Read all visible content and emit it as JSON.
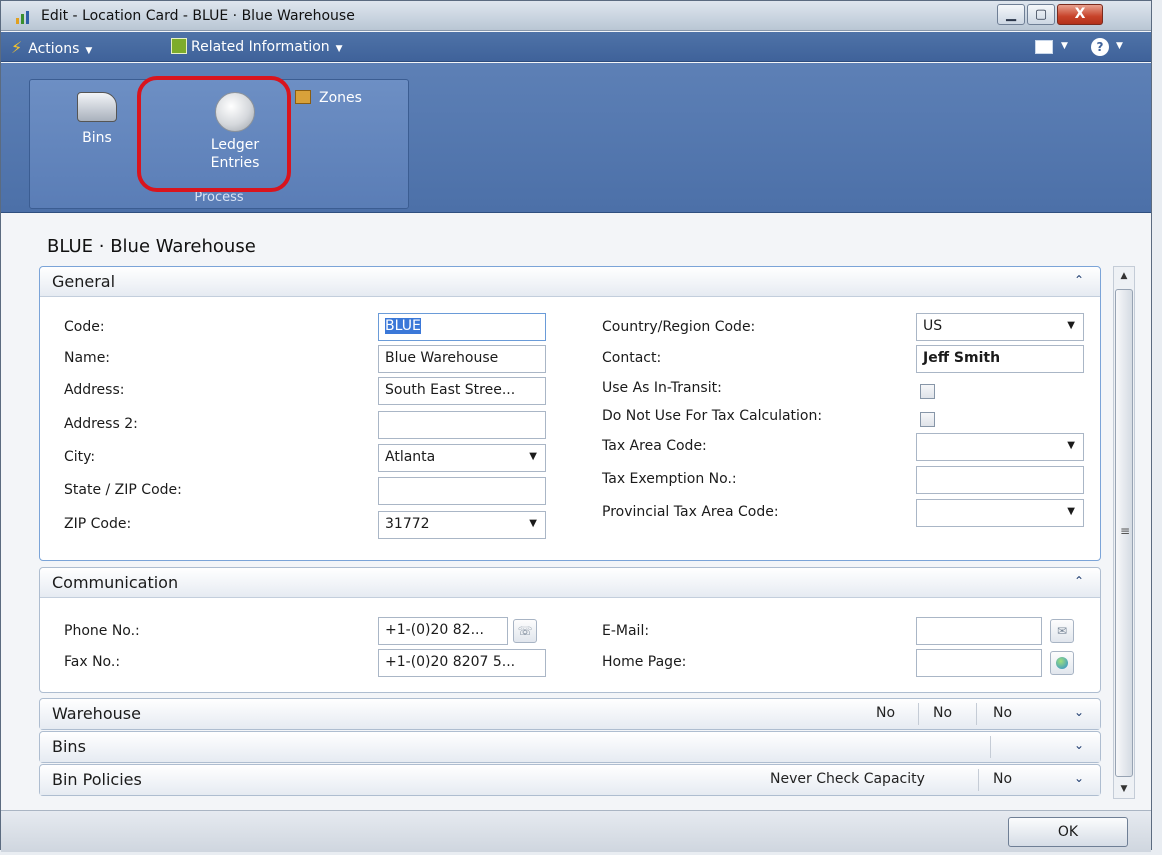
{
  "window": {
    "title": "Edit - Location Card - BLUE · Blue Warehouse",
    "min_glyph": "▁",
    "max_glyph": "▢",
    "close_glyph": "X"
  },
  "menu": {
    "actions": "Actions",
    "related": "Related Information",
    "help_glyph": "?",
    "caret": "▼"
  },
  "ribbon": {
    "bins": "Bins",
    "ledger_line1": "Ledger",
    "ledger_line2": "Entries",
    "zones": "Zones",
    "group_label": "Process"
  },
  "page_title": "BLUE · Blue Warehouse",
  "general": {
    "header": "General",
    "code_label": "Code:",
    "code_value": "BLUE",
    "name_label": "Name:",
    "name_value": "Blue Warehouse",
    "address_label": "Address:",
    "address_value": "South East Stree...",
    "address2_label": "Address 2:",
    "address2_value": "",
    "city_label": "City:",
    "city_value": "Atlanta",
    "state_label": "State / ZIP Code:",
    "state_value": "",
    "zip_label": "ZIP Code:",
    "zip_value": "31772",
    "country_label": "Country/Region Code:",
    "country_value": "US",
    "contact_label": "Contact:",
    "contact_value": "Jeff Smith",
    "transit_label": "Use As In-Transit:",
    "notax_label": "Do Not Use For Tax Calculation:",
    "taxarea_label": "Tax Area Code:",
    "taxarea_value": "",
    "taxexempt_label": "Tax Exemption No.:",
    "taxexempt_value": "",
    "provtax_label": "Provincial Tax Area Code:",
    "provtax_value": ""
  },
  "communication": {
    "header": "Communication",
    "phone_label": "Phone No.:",
    "phone_value": "+1-(0)20 82...",
    "fax_label": "Fax No.:",
    "fax_value": "+1-(0)20 8207 5...",
    "email_label": "E-Mail:",
    "email_value": "",
    "home_label": "Home Page:",
    "home_value": ""
  },
  "warehouse": {
    "header": "Warehouse",
    "v1": "No",
    "v2": "No",
    "v3": "No"
  },
  "bins": {
    "header": "Bins"
  },
  "bin_policies": {
    "header": "Bin Policies",
    "v1": "Never Check Capacity",
    "v2": "No"
  },
  "footer": {
    "ok": "OK"
  },
  "icons": {
    "collapse": "⌃",
    "expand": "⌄",
    "dropdown": "▼",
    "scroll_up": "▲",
    "scroll_down": "▼",
    "grip": "≡"
  },
  "colors": {
    "menubar": "#4f73a8",
    "ribbon": "#5d80b6",
    "highlight": "#d9141d",
    "selection": "#3b78d8"
  }
}
